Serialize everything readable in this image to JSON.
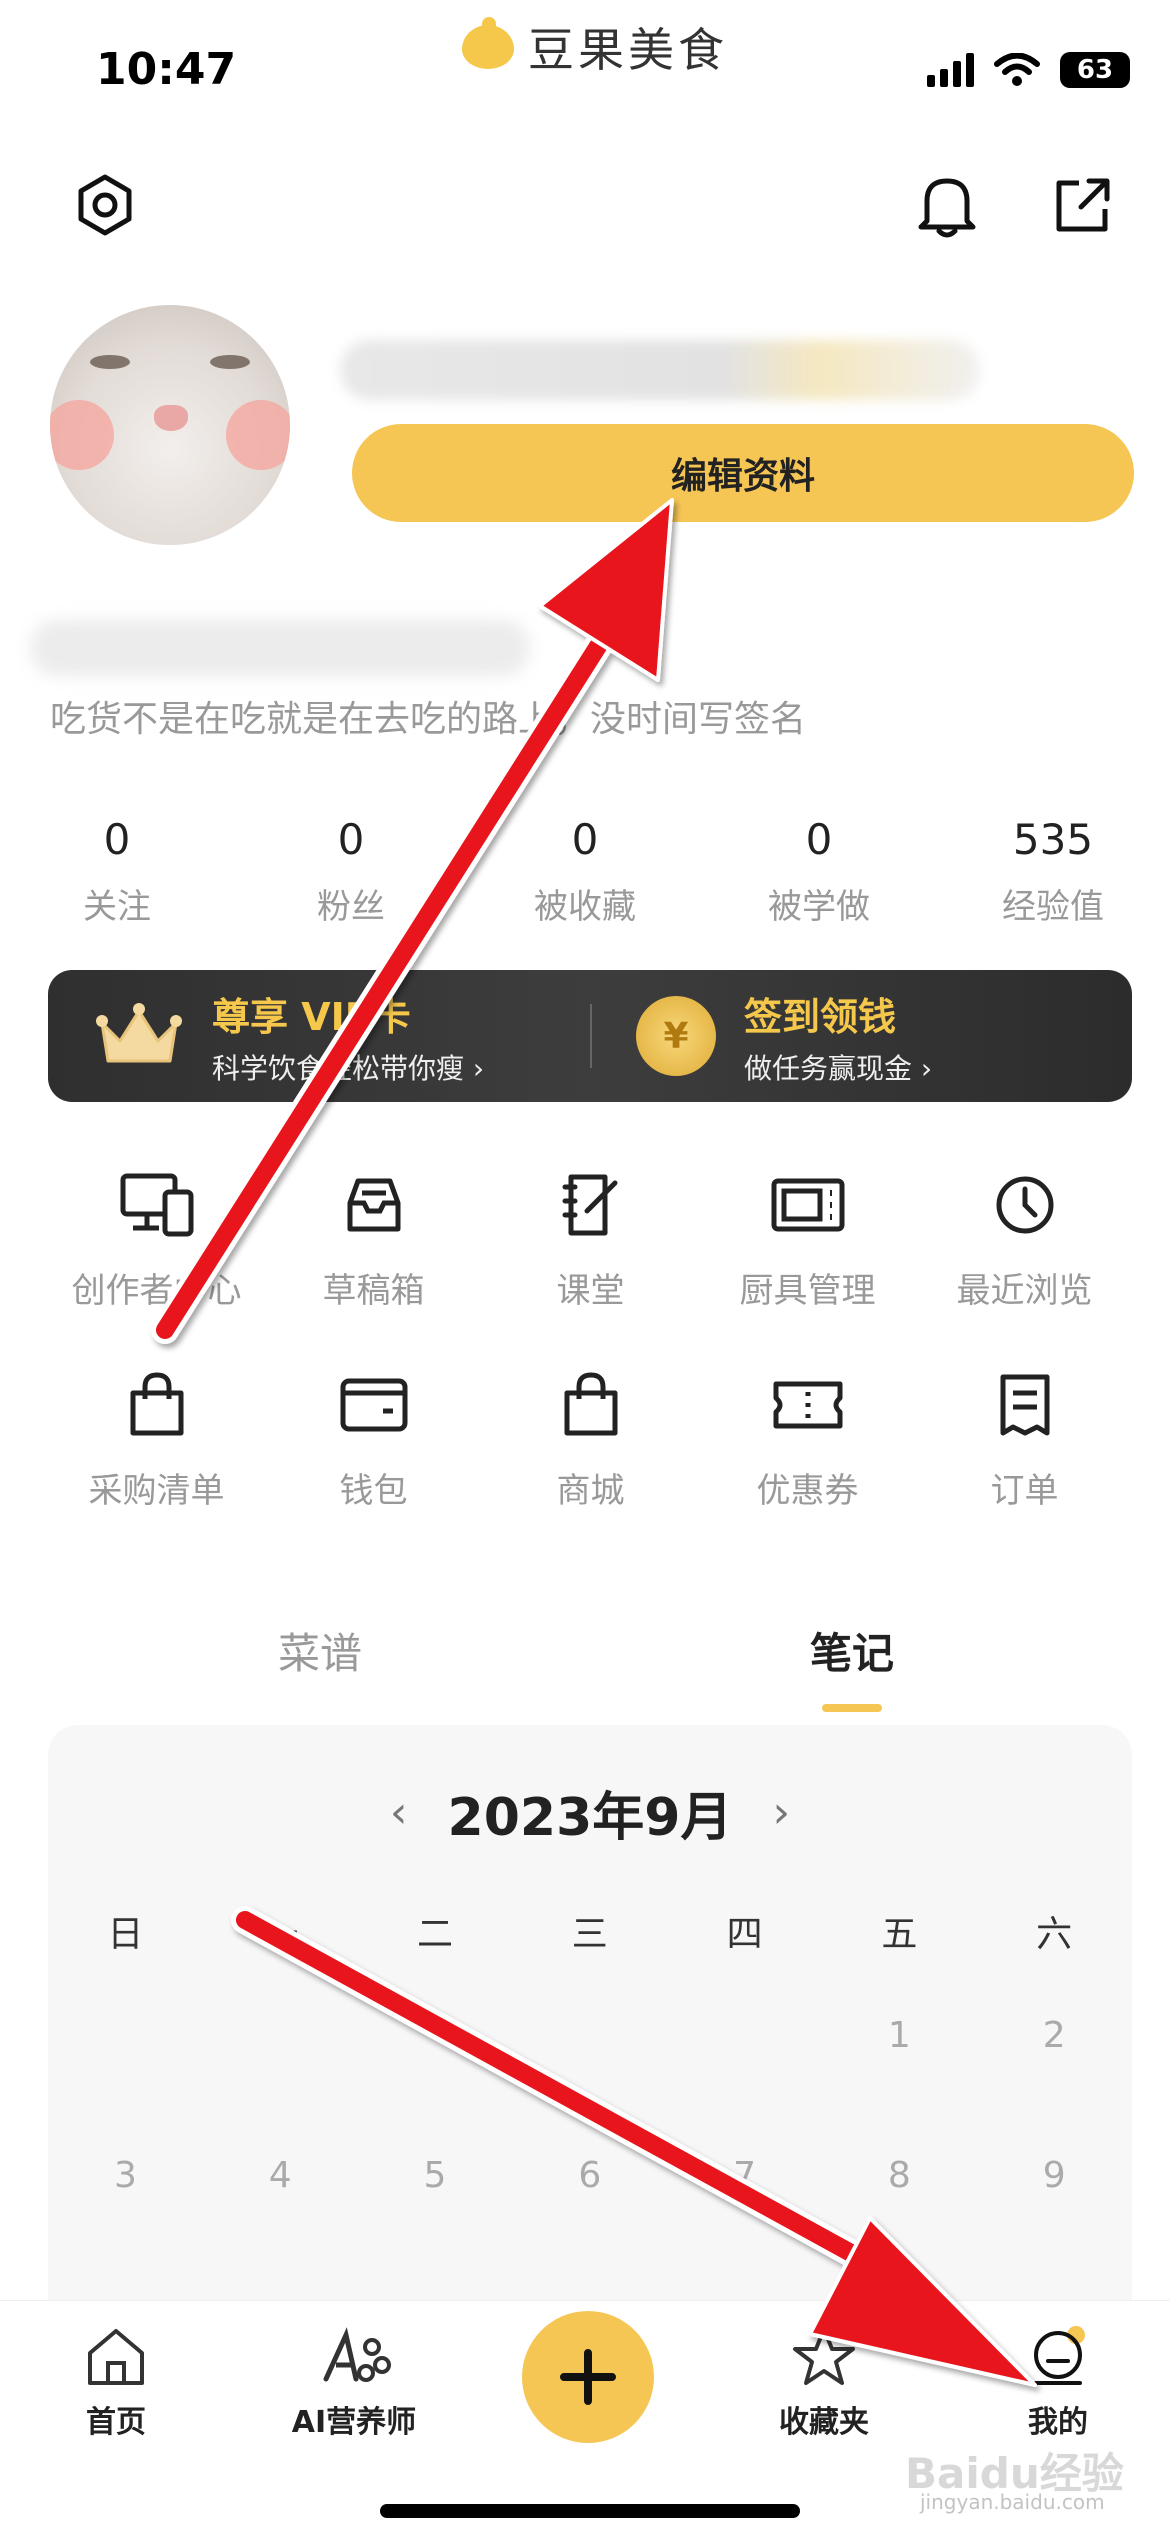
{
  "status_bar": {
    "time": "10:47",
    "app_name": "豆果美食",
    "battery": "63"
  },
  "profile": {
    "edit_button": "编辑资料",
    "bio": "吃货不是在吃就是在去吃的路上，没时间写签名"
  },
  "stats": [
    {
      "value": "0",
      "label": "关注"
    },
    {
      "value": "0",
      "label": "粉丝"
    },
    {
      "value": "0",
      "label": "被收藏"
    },
    {
      "value": "0",
      "label": "被学做"
    },
    {
      "value": "535",
      "label": "经验值"
    }
  ],
  "banner": {
    "vip_title": "尊享 VIP卡",
    "vip_sub": "科学饮食轻松带你瘦 ›",
    "checkin_title": "签到领钱",
    "checkin_sub": "做任务赢现金 ›",
    "coin_symbol": "¥"
  },
  "grid_row1": [
    {
      "label": "创作者中心",
      "icon": "devices-icon"
    },
    {
      "label": "草稿箱",
      "icon": "inbox-icon"
    },
    {
      "label": "课堂",
      "icon": "notebook-icon"
    },
    {
      "label": "厨具管理",
      "icon": "microwave-icon"
    },
    {
      "label": "最近浏览",
      "icon": "clock-icon"
    }
  ],
  "grid_row2": [
    {
      "label": "采购清单",
      "icon": "shopping-bag-icon"
    },
    {
      "label": "钱包",
      "icon": "wallet-icon"
    },
    {
      "label": "商城",
      "icon": "shopping-bag-icon"
    },
    {
      "label": "优惠券",
      "icon": "ticket-icon"
    },
    {
      "label": "订单",
      "icon": "receipt-icon"
    }
  ],
  "tabs": {
    "recipes": "菜谱",
    "notes": "笔记",
    "active": "notes"
  },
  "calendar": {
    "month": "2023年9月",
    "weekdays": [
      "日",
      "一",
      "二",
      "三",
      "四",
      "五",
      "六"
    ],
    "week1": [
      "",
      "",
      "",
      "",
      "",
      "1",
      "2"
    ],
    "week2": [
      "3",
      "4",
      "5",
      "6",
      "7",
      "8",
      "9"
    ]
  },
  "bottom_nav": {
    "home": "首页",
    "ai": "AI营养师",
    "favorites": "收藏夹",
    "mine": "我的"
  },
  "watermark": {
    "main": "Baidu经验",
    "sub": "jingyan.baidu.com"
  },
  "colors": {
    "accent": "#f6c655",
    "arrow": "#e8141c",
    "vip_gold": "#f5c84b"
  }
}
